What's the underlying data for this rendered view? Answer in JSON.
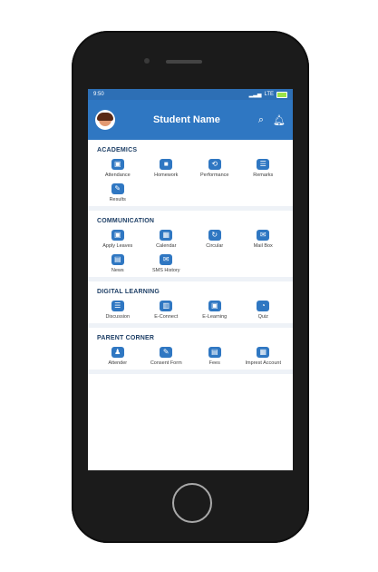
{
  "status": {
    "time": "9:50",
    "network": "LTE"
  },
  "header": {
    "title": "Student Name"
  },
  "sections": [
    {
      "title": "ACADEMICS",
      "items": [
        {
          "label": "Attendance",
          "icon": "attendance-icon",
          "glyph": "▣"
        },
        {
          "label": "Homework",
          "icon": "homework-icon",
          "glyph": "■"
        },
        {
          "label": "Performance",
          "icon": "performance-icon",
          "glyph": "⟲"
        },
        {
          "label": "Remarks",
          "icon": "remarks-icon",
          "glyph": "☰"
        },
        {
          "label": "Results",
          "icon": "results-icon",
          "glyph": "✎"
        }
      ]
    },
    {
      "title": "COMMUNICATION",
      "items": [
        {
          "label": "Apply Leaves",
          "icon": "apply-leaves-icon",
          "glyph": "▣"
        },
        {
          "label": "Calendar",
          "icon": "calendar-icon",
          "glyph": "▦"
        },
        {
          "label": "Circular",
          "icon": "circular-icon",
          "glyph": "↻"
        },
        {
          "label": "Mail Box",
          "icon": "mailbox-icon",
          "glyph": "✉"
        },
        {
          "label": "News",
          "icon": "news-icon",
          "glyph": "▤"
        },
        {
          "label": "SMS History",
          "icon": "sms-history-icon",
          "glyph": "✉"
        }
      ]
    },
    {
      "title": "DIGITAL LEARNING",
      "items": [
        {
          "label": "Discussion",
          "icon": "discussion-icon",
          "glyph": "☰"
        },
        {
          "label": "E-Connect",
          "icon": "econnect-icon",
          "glyph": "▥"
        },
        {
          "label": "E-Learning",
          "icon": "elearning-icon",
          "glyph": "▣"
        },
        {
          "label": "Quiz",
          "icon": "quiz-icon",
          "glyph": "◔"
        }
      ]
    },
    {
      "title": "PARENT CORNER",
      "items": [
        {
          "label": "Attender",
          "icon": "attender-icon",
          "glyph": "♟"
        },
        {
          "label": "Consent Form",
          "icon": "consent-form-icon",
          "glyph": "✎"
        },
        {
          "label": "Fees",
          "icon": "fees-icon",
          "glyph": "▤"
        },
        {
          "label": "Imprest Account",
          "icon": "imprest-account-icon",
          "glyph": "▦"
        }
      ]
    }
  ],
  "colors": {
    "primary": "#2f77c2",
    "header": "#2f77c2",
    "statusbar": "#2d6fb5",
    "phone": "#1b1b1b",
    "separator": "#eef2f7"
  }
}
